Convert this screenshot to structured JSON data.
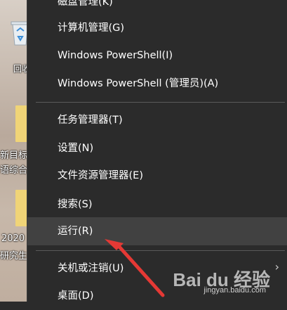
{
  "desktop": {
    "recycle_label": "回收",
    "file1_line1": "新目标",
    "file1_line2": "语综合",
    "file2_line1": "2020",
    "file2_line2": "研究生"
  },
  "menu": {
    "items": [
      {
        "label": "磁盘管理(K)"
      },
      {
        "label": "计算机管理(G)"
      },
      {
        "label": "Windows PowerShell(I)"
      },
      {
        "label": "Windows PowerShell (管理员)(A)"
      },
      {
        "label": "任务管理器(T)"
      },
      {
        "label": "设置(N)"
      },
      {
        "label": "文件资源管理器(E)"
      },
      {
        "label": "搜索(S)"
      },
      {
        "label": "运行(R)"
      },
      {
        "label": "关机或注销(U)"
      },
      {
        "label": "桌面(D)"
      }
    ],
    "highlighted_index": 8,
    "submenu_icon": "chevron-right-icon"
  },
  "watermark": {
    "brand": "Bai du 经验",
    "url": "jingyan.baidu.com"
  },
  "colors": {
    "menu_bg": "#2b2b2b",
    "hover_bg": "#414141",
    "annotation_arrow": "#e53935"
  }
}
